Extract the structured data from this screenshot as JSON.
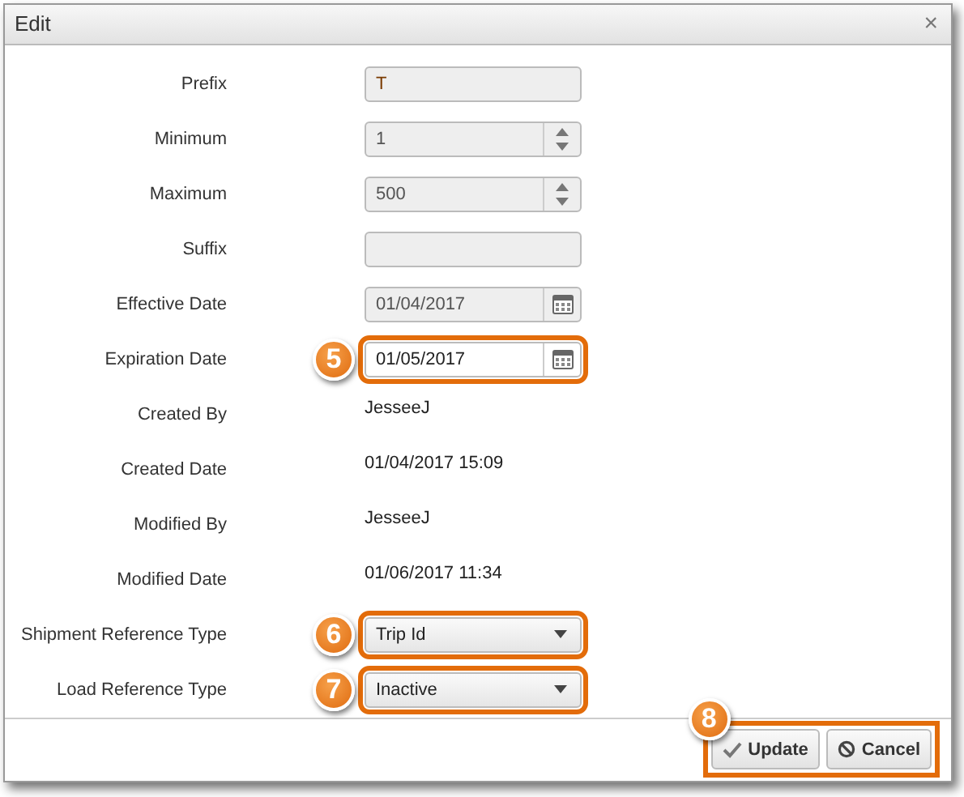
{
  "window": {
    "title": "Edit",
    "close": "×"
  },
  "fields": [
    {
      "label": "Prefix",
      "kind": "text",
      "value": "T",
      "disabled": true
    },
    {
      "label": "Minimum",
      "kind": "spinner",
      "value": "1",
      "disabled": true
    },
    {
      "label": "Maximum",
      "kind": "spinner",
      "value": "500",
      "disabled": true
    },
    {
      "label": "Suffix",
      "kind": "text",
      "disabled": true
    },
    {
      "label": "Effective Date",
      "kind": "date",
      "value": "01/04/2017",
      "disabled": true
    },
    {
      "label": "Expiration Date",
      "kind": "date",
      "value": "01/05/2017",
      "disabled": false,
      "callout": "5"
    },
    {
      "label": "Created By",
      "kind": "static",
      "value": "JesseeJ"
    },
    {
      "label": "Created Date",
      "kind": "static",
      "value": "01/04/2017 15:09"
    },
    {
      "label": "Modified By",
      "kind": "static",
      "value": "JesseeJ"
    },
    {
      "label": "Modified Date",
      "kind": "static",
      "value": "01/06/2017 11:34"
    },
    {
      "label": "Shipment Reference Type",
      "kind": "select",
      "value": "Trip Id",
      "disabled": false,
      "callout": "6"
    },
    {
      "label": "Load Reference Type",
      "kind": "select",
      "value": "Inactive",
      "disabled": false,
      "callout": "7"
    }
  ],
  "footer": {
    "callout": "8",
    "buttons": [
      {
        "label": "Update",
        "kind": "update"
      },
      {
        "label": "Cancel",
        "kind": "cancel"
      }
    ]
  }
}
